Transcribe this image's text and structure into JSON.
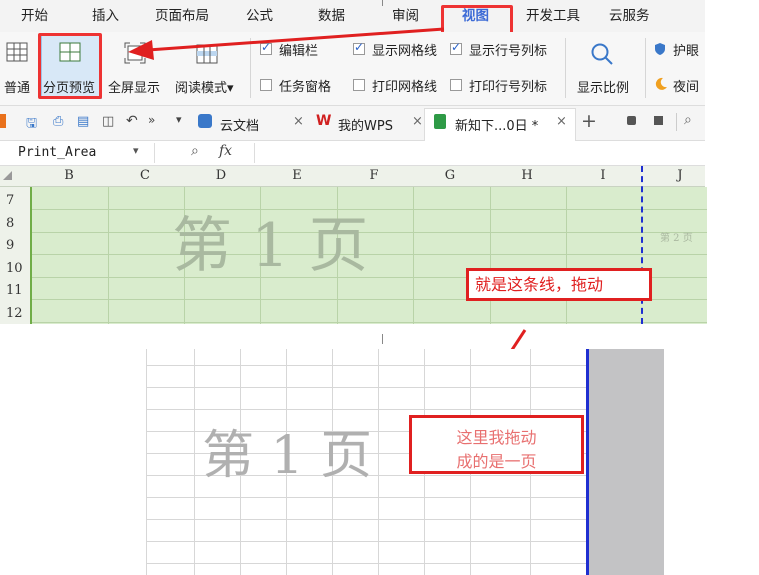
{
  "menu": [
    "开始",
    "插入",
    "页面布局",
    "公式",
    "数据",
    "审阅",
    "视图",
    "开发工具",
    "云服务"
  ],
  "ribbon": {
    "normal": "普通",
    "page_break_preview": "分页预览",
    "full_screen": "全屏显示",
    "reading_mode": "阅读模式▾",
    "edit_bar": "编辑栏",
    "task_pane": "任务窗格",
    "show_gridlines": "显示网格线",
    "print_gridlines": "打印网格线",
    "show_headers": "显示行号列标",
    "print_headers": "打印行号列标",
    "zoom": "显示比例",
    "eye_care": "护眼",
    "night_mode": "夜间"
  },
  "tabs": [
    {
      "label": "云文档"
    },
    {
      "label": "我的WPS"
    },
    {
      "label": "新知下...0日 *"
    }
  ],
  "formula_bar": {
    "name_box": "Print_Area",
    "fx": "fx"
  },
  "sheet": {
    "columns": [
      "B",
      "C",
      "D",
      "E",
      "F",
      "G",
      "H",
      "I",
      "J"
    ],
    "rows": [
      "7",
      "8",
      "9",
      "10",
      "11",
      "12"
    ],
    "watermark": "第 1 页",
    "watermark2": "第 2 页"
  },
  "annotations": {
    "callout1": "就是这条线，拖动",
    "callout2_line1": "这里我拖动",
    "callout2_line2": "成的是一页"
  },
  "preview": {
    "watermark": "第 1 页"
  },
  "colors": {
    "accent_red": "#e02020",
    "sheet_green": "#d9eccd",
    "page_border_blue": "#1f2fd0",
    "view_tab_blue": "#3d6bd6"
  }
}
